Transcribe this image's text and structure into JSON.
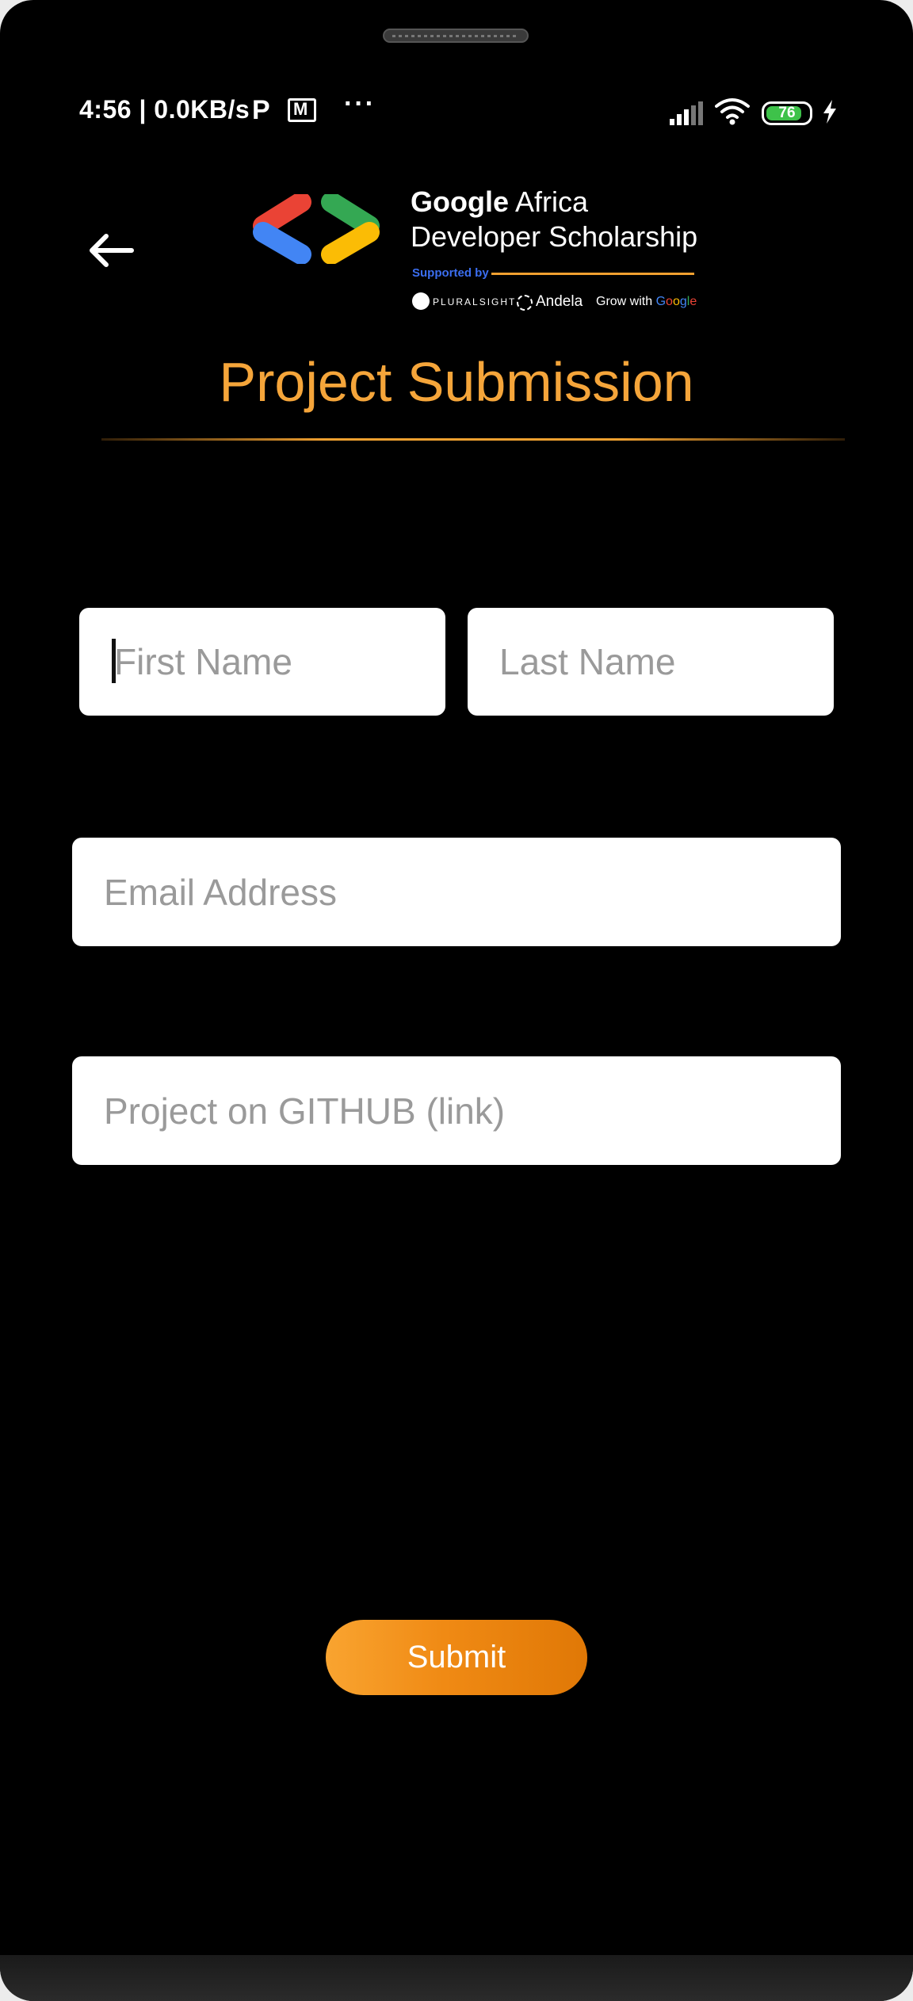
{
  "status_bar": {
    "time_speed": "4:56 | 0.0KB/s",
    "more": "···",
    "battery_level": "76",
    "icons": [
      "p-app-icon",
      "mail-icon",
      "more-icon",
      "signal-icon",
      "wifi-icon",
      "battery-icon",
      "charging-icon"
    ]
  },
  "header": {
    "back_icon": "arrow-left-icon",
    "logo": {
      "brand": "Google",
      "line1_rest": " Africa",
      "line2": "Developer Scholarship",
      "supported_by": "Supported by",
      "partners": {
        "pluralsight": "PLURALSIGHT",
        "andela": "Andela",
        "grow_with": "Grow with ",
        "google_letters": [
          "G",
          "o",
          "o",
          "g",
          "l",
          "e"
        ]
      }
    },
    "title": "Project Submission"
  },
  "form": {
    "first_name_placeholder": "First Name",
    "last_name_placeholder": "Last Name",
    "email_placeholder": "Email Address",
    "github_placeholder": "Project on GITHUB (link)",
    "submit_label": "Submit"
  },
  "colors": {
    "background": "#000000",
    "accent": "#f5a53a",
    "button_start": "#f9a430",
    "button_end": "#e07806",
    "supported_by": "#3b6ef0"
  }
}
